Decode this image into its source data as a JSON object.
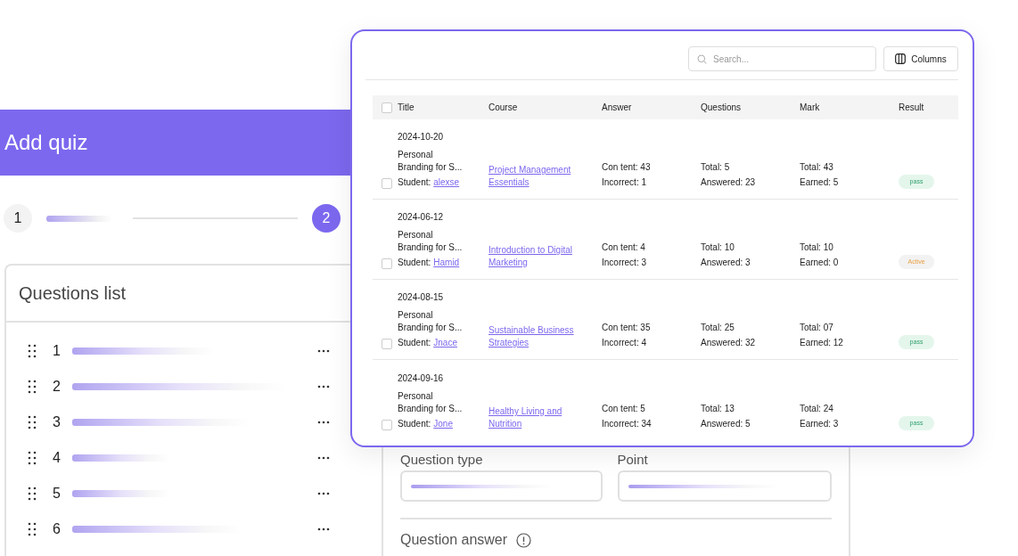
{
  "header": {
    "title": "Add quiz"
  },
  "steps": [
    {
      "label": "1",
      "selected": false
    },
    {
      "label": "2",
      "selected": true
    }
  ],
  "questions_list": {
    "title": "Questions list",
    "items": [
      {
        "number": "1"
      },
      {
        "number": "2"
      },
      {
        "number": "3"
      },
      {
        "number": "4"
      },
      {
        "number": "5"
      },
      {
        "number": "6"
      }
    ]
  },
  "question_form": {
    "fields": [
      {
        "label": "Question type"
      },
      {
        "label": "Point"
      }
    ],
    "answer_label": "Question answer"
  },
  "results_window": {
    "search": {
      "placeholder": "Search..."
    },
    "columns_button": "Columns",
    "table": {
      "header_checked": false,
      "columns": [
        "Title",
        "Course",
        "Answer",
        "Questions",
        "Mark",
        "Result"
      ],
      "rows": [
        {
          "checked": false,
          "date": "2024-10-20",
          "title": "Personal Branding for S...",
          "student_label": "Student:",
          "student": "alexse",
          "course": "Project Management Essentials",
          "answer": [
            "Con tent: 43",
            "Incorrect: 1"
          ],
          "questions": [
            "Total: 5",
            "Answered: 23"
          ],
          "mark": [
            "Total: 43",
            "Earned: 5"
          ],
          "result": {
            "label": "pass",
            "kind": "pass"
          }
        },
        {
          "checked": false,
          "date": "2024-06-12",
          "title": "Personal Branding for S...",
          "student_label": "Student:",
          "student": "Hamid",
          "course": "Introduction to Digital Marketing",
          "answer": [
            "Con tent: 4",
            "Incorrect: 3"
          ],
          "questions": [
            "Total: 10",
            "Answered: 3"
          ],
          "mark": [
            "Total: 10",
            "Earned: 0"
          ],
          "result": {
            "label": "Active",
            "kind": "active"
          }
        },
        {
          "checked": false,
          "date": "2024-08-15",
          "title": "Personal Branding for S...",
          "student_label": "Student:",
          "student": "Jnace",
          "course": "Sustainable Business Strategies",
          "answer": [
            "Con tent: 35",
            "Incorrect: 4"
          ],
          "questions": [
            "Total: 25",
            "Answered: 32"
          ],
          "mark": [
            "Total: 07",
            "Earned: 12"
          ],
          "result": {
            "label": "pass",
            "kind": "pass"
          }
        },
        {
          "checked": false,
          "date": "2024-09-16",
          "title": "Personal Branding for S...",
          "student_label": "Student:",
          "student": "Jone",
          "course": "Healthy Living and Nutrition",
          "answer": [
            "Con tent: 5",
            "Incorrect: 34"
          ],
          "questions": [
            "Total: 13",
            "Answered: 5"
          ],
          "mark": [
            "Total: 24",
            "Earned: 3"
          ],
          "result": {
            "label": "pass",
            "kind": "pass"
          }
        }
      ]
    }
  }
}
